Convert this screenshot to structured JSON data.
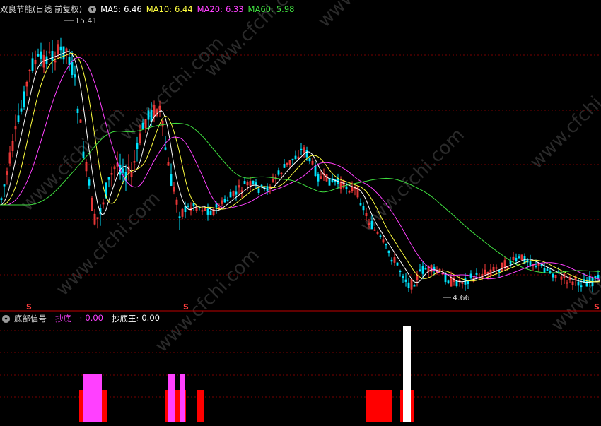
{
  "main": {
    "title": "双良节能(日线 前复权)",
    "ma": [
      {
        "label": "MA5:",
        "value": "6.46",
        "color": "#ffffff"
      },
      {
        "label": "MA10:",
        "value": "6.44",
        "color": "#ffff40"
      },
      {
        "label": "MA20:",
        "value": "6.33",
        "color": "#ff40ff"
      },
      {
        "label": "MA60:",
        "value": "5.98",
        "color": "#40e040"
      }
    ],
    "high_label": "15.41",
    "low_label": "4.66",
    "signal_mark": "S"
  },
  "indicator": {
    "title": "底部信号",
    "items": [
      {
        "label": "抄底二:",
        "value": "0.00",
        "color": "#ff40ff"
      },
      {
        "label": "抄底王:",
        "value": "0.00",
        "color": "#ffffff"
      }
    ]
  },
  "watermark": "www.cfchi.com",
  "colors": {
    "up": "#ff3c3c",
    "down": "#00e5ff",
    "grid": "#7a0000",
    "divider": "#c00000",
    "bar_red": "#ff0000",
    "bar_magenta": "#ff40ff",
    "bar_white": "#ffffff"
  }
}
